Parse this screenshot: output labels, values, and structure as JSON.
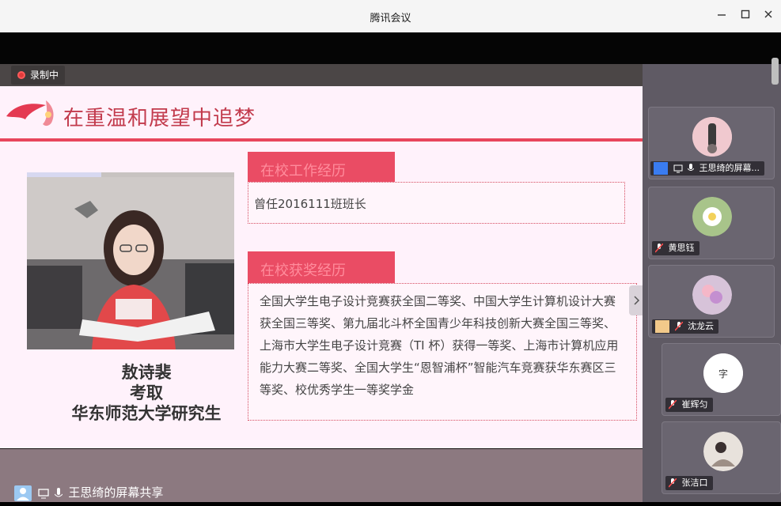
{
  "window": {
    "title": "腾讯会议",
    "minimize_icon": "minimize-icon",
    "maximize_icon": "maximize-icon",
    "close_icon": "close-icon"
  },
  "recording": {
    "label": "录制中"
  },
  "slide": {
    "title": "在重温和展望中追梦",
    "caption_lines": [
      "敖诗裴",
      "考取",
      "华东师范大学研究生"
    ],
    "sections": [
      {
        "header": "在校工作经历",
        "content": "曾任2016111班班长"
      },
      {
        "header": "在校获奖经历",
        "content": "全国大学生电子设计竞赛获全国二等奖、中国大学生计算机设计大赛获全国三等奖、第九届北斗杯全国青少年科技创新大赛全国三等奖、上海市大学生电子设计竞赛（TI 杯）获得一等奖、上海市计算机应用能力大赛二等奖、全国大学生“恩智浦杯”智能汽车竞赛获华东赛区三等奖、校优秀学生一等奖学金"
      }
    ]
  },
  "participants": [
    {
      "name": "王思绮的屏幕...",
      "has_screen_icon": true
    },
    {
      "name": "黄思钰"
    },
    {
      "name": "沈龙云"
    },
    {
      "name": "崔辉匀"
    },
    {
      "name": "张洁口"
    }
  ],
  "share": {
    "label": "王思绮的屏幕共享"
  },
  "colors": {
    "accent": "#e8465c",
    "panel": "#5f5a64"
  }
}
